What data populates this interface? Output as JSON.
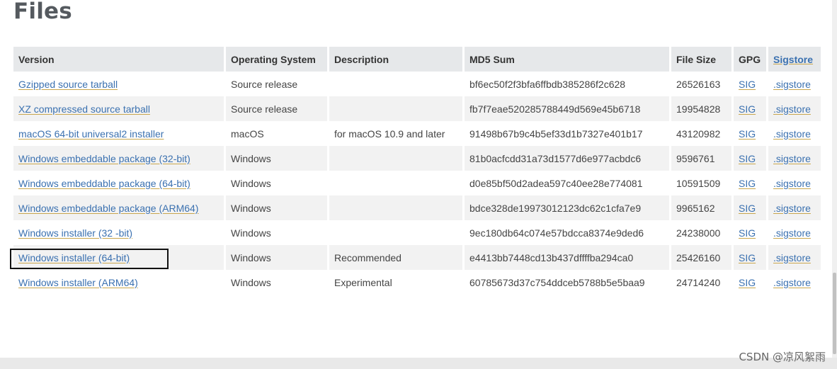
{
  "page": {
    "title": "Files"
  },
  "table": {
    "headers": {
      "version": "Version",
      "os": "Operating System",
      "description": "Description",
      "md5": "MD5 Sum",
      "size": "File Size",
      "gpg": "GPG",
      "sigstore": "Sigstore"
    },
    "rows": [
      {
        "version": "Gzipped source tarball",
        "os": "Source release",
        "description": "",
        "md5": "bf6ec50f2f3bfa6ffbdb385286f2c628",
        "size": "26526163",
        "gpg": "SIG",
        "sigstore": ".sigstore"
      },
      {
        "version": "XZ compressed source tarball",
        "os": "Source release",
        "description": "",
        "md5": "fb7f7eae520285788449d569e45b6718",
        "size": "19954828",
        "gpg": "SIG",
        "sigstore": ".sigstore"
      },
      {
        "version": "macOS 64-bit universal2 installer",
        "os": "macOS",
        "description": "for macOS 10.9 and later",
        "md5": "91498b67b9c4b5ef33d1b7327e401b17",
        "size": "43120982",
        "gpg": "SIG",
        "sigstore": ".sigstore"
      },
      {
        "version": "Windows embeddable package (32-bit)",
        "os": "Windows",
        "description": "",
        "md5": "81b0acfcdd31a73d1577d6e977acbdc6",
        "size": "9596761",
        "gpg": "SIG",
        "sigstore": ".sigstore"
      },
      {
        "version": "Windows embeddable package (64-bit)",
        "os": "Windows",
        "description": "",
        "md5": "d0e85bf50d2adea597c40ee28e774081",
        "size": "10591509",
        "gpg": "SIG",
        "sigstore": ".sigstore"
      },
      {
        "version": "Windows embeddable package (ARM64)",
        "os": "Windows",
        "description": "",
        "md5": "bdce328de19973012123dc62c1cfa7e9",
        "size": "9965162",
        "gpg": "SIG",
        "sigstore": ".sigstore"
      },
      {
        "version": "Windows installer (32 -bit)",
        "os": "Windows",
        "description": "",
        "md5": "9ec180db64c074e57bdcca8374e9ded6",
        "size": "24238000",
        "gpg": "SIG",
        "sigstore": ".sigstore"
      },
      {
        "version": "Windows installer (64-bit)",
        "os": "Windows",
        "description": "Recommended",
        "md5": "e4413bb7448cd13b437dffffba294ca0",
        "size": "25426160",
        "gpg": "SIG",
        "sigstore": ".sigstore"
      },
      {
        "version": "Windows installer (ARM64)",
        "os": "Windows",
        "description": "Experimental",
        "md5": "60785673d37c754ddceb5788b5e5baa9",
        "size": "24714240",
        "gpg": "SIG",
        "sigstore": ".sigstore"
      }
    ]
  },
  "watermark": "CSDN @凉风絮雨",
  "colors": {
    "link": "#3b71b0",
    "header_bg": "#e6e8ea",
    "stripe_bg": "#f2f2f2",
    "highlight": "#111111"
  }
}
